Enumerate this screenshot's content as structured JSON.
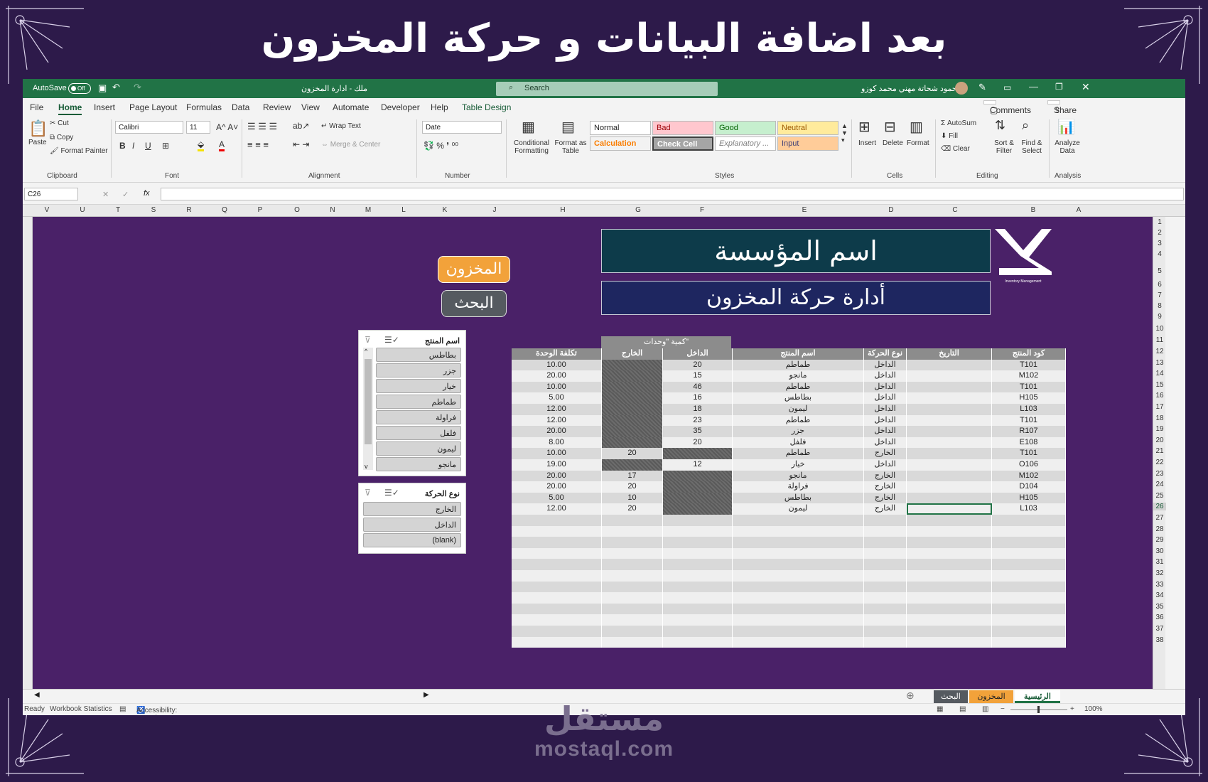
{
  "page": {
    "headline": "بعد اضافة البيانات و حركة المخزون"
  },
  "watermark": {
    "arabic": "مستقل",
    "latin": "mostaql.com"
  },
  "titlebar": {
    "autosave": "AutoSave",
    "toggle": "Off",
    "doc_title": "ملك - ادارة المخزون",
    "search_placeholder": "Search",
    "user": "محمود شحاتة مهني محمد كوزو"
  },
  "menu": [
    "File",
    "Home",
    "Insert",
    "Page Layout",
    "Formulas",
    "Data",
    "Review",
    "View",
    "Automate",
    "Developer",
    "Help",
    "Table Design"
  ],
  "menu_right": {
    "comments": "Comments",
    "share": "Share"
  },
  "ribbon": {
    "clipboard": {
      "paste": "Paste",
      "cut": "Cut",
      "copy": "Copy",
      "format_painter": "Format Painter",
      "label": "Clipboard"
    },
    "font": {
      "name": "Calibri",
      "size": "11",
      "label": "Font"
    },
    "alignment": {
      "wrap": "Wrap Text",
      "merge": "Merge & Center",
      "label": "Alignment"
    },
    "number": {
      "format": "Date",
      "label": "Number"
    },
    "styles": {
      "conditional": "Conditional Formatting",
      "format_table": "Format as Table",
      "normal": "Normal",
      "bad": "Bad",
      "good": "Good",
      "neutral": "Neutral",
      "calculation": "Calculation",
      "check_cell": "Check Cell",
      "explanatory": "Explanatory ...",
      "input": "Input",
      "label": "Styles"
    },
    "cells": {
      "insert": "Insert",
      "delete": "Delete",
      "format": "Format",
      "label": "Cells"
    },
    "editing": {
      "autosum": "AutoSum",
      "fill": "Fill",
      "clear": "Clear",
      "sort": "Sort & Filter",
      "find": "Find & Select",
      "label": "Editing"
    },
    "analysis": {
      "analyze": "Analyze Data",
      "label": "Analysis"
    }
  },
  "formula_bar": {
    "name_box": "C26",
    "formula": ""
  },
  "columns": [
    "V",
    "U",
    "T",
    "S",
    "R",
    "Q",
    "P",
    "O",
    "N",
    "M",
    "L",
    "K",
    "J",
    "H",
    "G",
    "F",
    "E",
    "D",
    "C",
    "B",
    "A"
  ],
  "rows": [
    "1",
    "2",
    "3",
    "4",
    "5",
    "6",
    "7",
    "8",
    "9",
    "10",
    "11",
    "12",
    "13",
    "14",
    "15",
    "16",
    "17",
    "18",
    "19",
    "20",
    "21",
    "22",
    "23",
    "24",
    "25",
    "26",
    "27",
    "28",
    "29",
    "30",
    "31",
    "32",
    "33",
    "34",
    "35",
    "36",
    "37",
    "38"
  ],
  "sheet": {
    "company": "اسم المؤسسة",
    "subtitle": "أدارة حركة المخزون",
    "logo_caption": "Inventory Management",
    "btn_inventory": "المخزون",
    "btn_search": "البحث",
    "qty_group": "كمية \"وحدات\"",
    "headers": {
      "code": "كود المنتج",
      "date": "التاريخ",
      "type": "نوع الحركة",
      "name": "اسم المنتج",
      "in": "الداخل",
      "out": "الخارج",
      "cost": "تكلفة الوحدة"
    },
    "table": [
      {
        "code": "T101",
        "type": "الداخل",
        "name": "طماطم",
        "in": "20",
        "out": "",
        "cost": "10.00"
      },
      {
        "code": "M102",
        "type": "الداخل",
        "name": "مانجو",
        "in": "15",
        "out": "",
        "cost": "20.00"
      },
      {
        "code": "T101",
        "type": "الداخل",
        "name": "طماطم",
        "in": "46",
        "out": "",
        "cost": "10.00"
      },
      {
        "code": "H105",
        "type": "الداخل",
        "name": "بطاطس",
        "in": "16",
        "out": "",
        "cost": "5.00"
      },
      {
        "code": "L103",
        "type": "الداخل",
        "name": "ليمون",
        "in": "18",
        "out": "",
        "cost": "12.00"
      },
      {
        "code": "T101",
        "type": "الداخل",
        "name": "طماطم",
        "in": "23",
        "out": "",
        "cost": "12.00"
      },
      {
        "code": "R107",
        "type": "الداخل",
        "name": "جزر",
        "in": "35",
        "out": "",
        "cost": "20.00"
      },
      {
        "code": "E108",
        "type": "الداخل",
        "name": "فلفل",
        "in": "20",
        "out": "",
        "cost": "8.00"
      },
      {
        "code": "T101",
        "type": "الخارج",
        "name": "طماطم",
        "in": "",
        "out": "20",
        "cost": "10.00"
      },
      {
        "code": "O106",
        "type": "الداخل",
        "name": "خيار",
        "in": "12",
        "out": "",
        "cost": "19.00"
      },
      {
        "code": "M102",
        "type": "الخارج",
        "name": "مانجو",
        "in": "",
        "out": "17",
        "cost": "20.00"
      },
      {
        "code": "D104",
        "type": "الخارج",
        "name": "فراولة",
        "in": "",
        "out": "20",
        "cost": "20.00"
      },
      {
        "code": "H105",
        "type": "الخارج",
        "name": "بطاطس",
        "in": "",
        "out": "10",
        "cost": "5.00"
      },
      {
        "code": "L103",
        "type": "الخارج",
        "name": "ليمون",
        "in": "",
        "out": "20",
        "cost": "12.00"
      }
    ],
    "slicer_product": {
      "title": "اسم المنتج",
      "items": [
        "بطاطس",
        "جزر",
        "خيار",
        "طماطم",
        "فراولة",
        "فلفل",
        "ليمون",
        "مانجو"
      ]
    },
    "slicer_type": {
      "title": "نوع الحركة",
      "items": [
        "الخارج",
        "الداخل",
        "(blank)"
      ]
    }
  },
  "tabs": {
    "home": "الرئيسية",
    "inventory": "المخزون",
    "search": "البحث"
  },
  "status": {
    "ready": "Ready",
    "stats": "Workbook Statistics",
    "access": "Accessibility: Investigate",
    "zoom": "100%"
  },
  "colors": {
    "excel_green": "#217346",
    "sheet_bg": "#4a2168",
    "navy": "#0d3b4a",
    "orange": "#f2a23a"
  }
}
